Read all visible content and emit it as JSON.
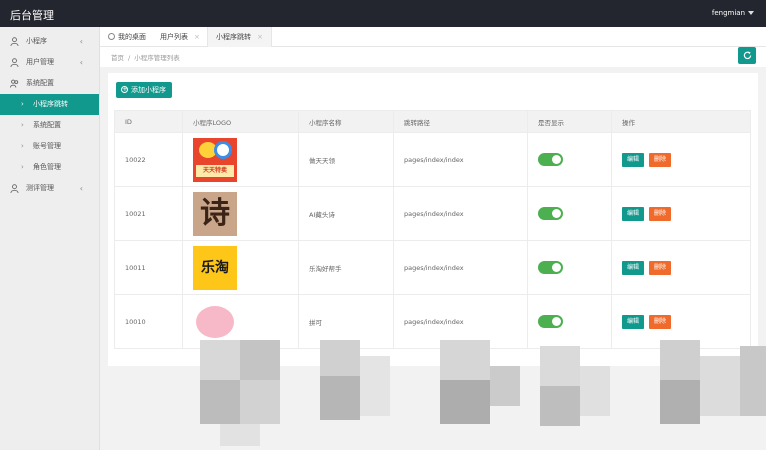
{
  "app": {
    "title": "后台管理",
    "user": "fengmian"
  },
  "sidebar": {
    "items": [
      {
        "label": "小程序",
        "icon": "user-icon",
        "chevron": "‹"
      },
      {
        "label": "用户管理",
        "icon": "user-icon",
        "chevron": "‹"
      },
      {
        "label": "系统配置",
        "icon": "group-icon",
        "chevron": ""
      }
    ],
    "sub_items": [
      {
        "label": "小程序跳转",
        "active": true
      },
      {
        "label": "系统配置",
        "active": false
      },
      {
        "label": "账号管理",
        "active": false
      },
      {
        "label": "角色管理",
        "active": false
      }
    ],
    "tail_item": {
      "label": "测评管理",
      "icon": "user-icon",
      "chevron": "‹"
    }
  },
  "tabs": [
    {
      "label": "我的桌面",
      "icon": "home-icon"
    },
    {
      "label": "用户列表",
      "close": "×"
    },
    {
      "label": "小程序跳转",
      "close": "×"
    }
  ],
  "breadcrumb": {
    "home": "首页",
    "separator": "/",
    "current": "小程序管理列表"
  },
  "toolbar": {
    "add_label": "添加小程序"
  },
  "table": {
    "columns": [
      "ID",
      "小程序LOGO",
      "小程序名称",
      "跳转路径",
      "是否显示",
      "操作"
    ],
    "rows": [
      {
        "id": "10022",
        "logo_text": "天天特卖",
        "name": "做天天领",
        "path": "pages/index/index",
        "show": true
      },
      {
        "id": "10021",
        "logo_text": "诗",
        "name": "AI藏头诗",
        "path": "pages/index/index",
        "show": true
      },
      {
        "id": "10011",
        "logo_text": "乐淘",
        "name": "乐淘好帮手",
        "path": "pages/index/index",
        "show": true
      },
      {
        "id": "10010",
        "logo_text": "",
        "name": "拼可",
        "path": "pages/index/index",
        "show": true
      }
    ],
    "edit_label": "编辑",
    "delete_label": "删除"
  },
  "colors": {
    "accent": "#11998e",
    "danger": "#ef6a2b",
    "toggle_on": "#4caf50",
    "topbar": "#23262e"
  }
}
